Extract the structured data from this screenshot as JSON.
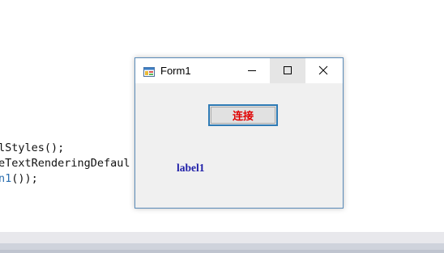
{
  "editor": {
    "lines": [
      {
        "text": "lStyles();"
      },
      {
        "text": "eTextRenderingDefaul"
      },
      {
        "text_blue": "n1",
        "text": "());"
      }
    ]
  },
  "window": {
    "title": "Form1",
    "connect_button_label": "连接",
    "label1_text": "label1"
  },
  "colors": {
    "window_border": "#5a8bb8",
    "button_text": "#e00000",
    "label_text": "#1f1fa8",
    "button_border": "#2f7bb5"
  },
  "icons": {
    "app": "form-app-icon",
    "minimize": "minimize-icon",
    "maximize": "maximize-icon",
    "close": "close-icon"
  }
}
